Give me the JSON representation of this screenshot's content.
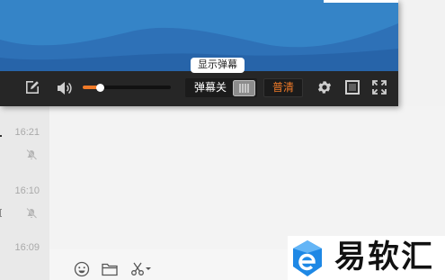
{
  "player": {
    "tooltip": "显示弹幕",
    "danmaku_label": "弹幕关",
    "quality_label": "普清",
    "volume_level": 0.2,
    "icons": {
      "edit": "edit-icon",
      "volume": "volume-icon",
      "danmaku_toggle": "danmaku-toggle-icon",
      "settings": "gear-icon",
      "web_fullscreen": "web-fullscreen-icon",
      "fullscreen": "fullscreen-icon"
    }
  },
  "sidebar": {
    "items": [
      {
        "time": "16:21",
        "muted": true,
        "icon": "muted-bell-icon"
      },
      {
        "time": "16:10",
        "muted": true,
        "icon": "muted-bell-icon"
      },
      {
        "time": "16:09",
        "muted": false
      }
    ]
  },
  "input_toolbar": {
    "icons": [
      "emoji-icon",
      "folder-icon",
      "scissors-icon",
      "chevron-down-icon"
    ]
  },
  "watermark": {
    "text": "易软汇",
    "icon": "e-logo-icon"
  },
  "colors": {
    "accent": "#f07a28",
    "video_blue": "#3584c7",
    "control_bar": "#262626"
  }
}
